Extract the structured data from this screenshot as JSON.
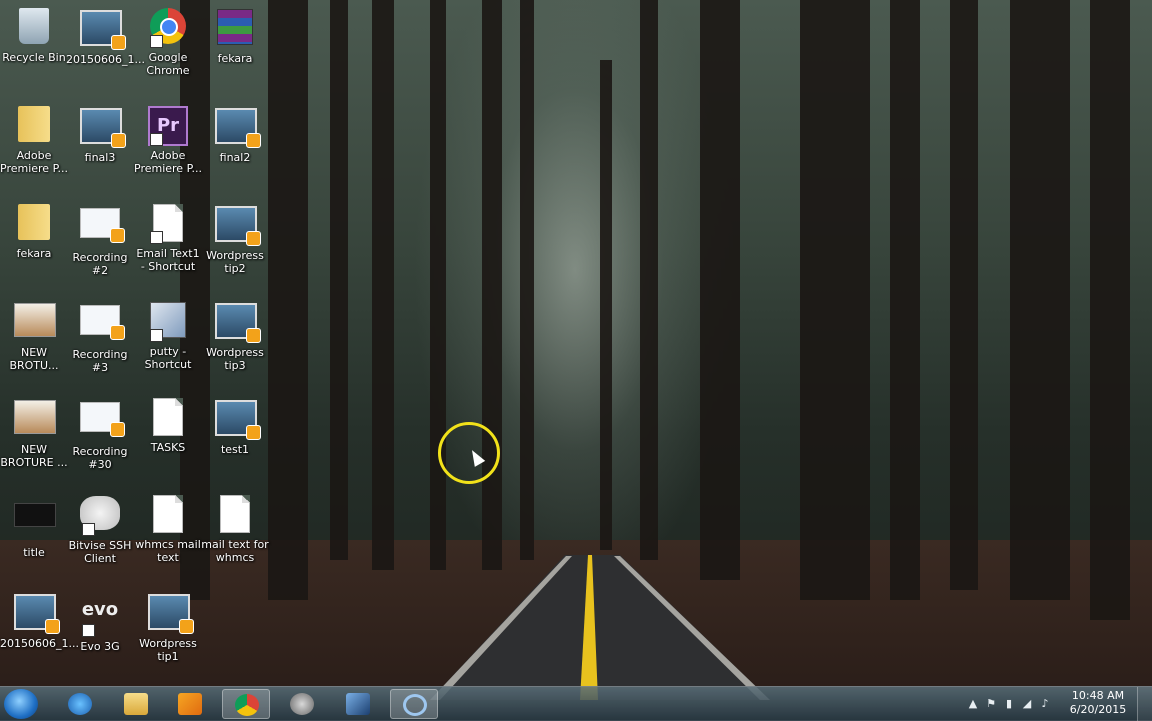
{
  "desktop": {
    "icons": [
      {
        "label": "Recycle Bin",
        "kind": "recycle-bin"
      },
      {
        "label": "20150606_1...",
        "kind": "video-file"
      },
      {
        "label": "Google Chrome",
        "kind": "chrome-shortcut"
      },
      {
        "label": "fekara",
        "kind": "rar-archive"
      },
      {
        "label": "Adobe Premiere P...",
        "kind": "folder"
      },
      {
        "label": "final3",
        "kind": "video-file"
      },
      {
        "label": "Adobe Premiere P...",
        "kind": "premiere-shortcut"
      },
      {
        "label": "final2",
        "kind": "video-file"
      },
      {
        "label": "fekara",
        "kind": "folder"
      },
      {
        "label": "Recording #2",
        "kind": "recording-file"
      },
      {
        "label": "Email Text1 - Shortcut",
        "kind": "text-shortcut"
      },
      {
        "label": "Wordpress tip2",
        "kind": "video-file"
      },
      {
        "label": "NEW BROTU...",
        "kind": "brochure-image"
      },
      {
        "label": "Recording #3",
        "kind": "recording-file"
      },
      {
        "label": "putty - Shortcut",
        "kind": "putty-shortcut"
      },
      {
        "label": "Wordpress tip3",
        "kind": "video-file"
      },
      {
        "label": "NEW BROTURE ...",
        "kind": "brochure-image"
      },
      {
        "label": "Recording #30",
        "kind": "recording-file"
      },
      {
        "label": "TASKS",
        "kind": "text-file"
      },
      {
        "label": "test1",
        "kind": "video-file"
      },
      {
        "label": "title",
        "kind": "title-image"
      },
      {
        "label": "Bitvise SSH Client",
        "kind": "bitvise-shortcut"
      },
      {
        "label": "whmcs mail text",
        "kind": "text-file"
      },
      {
        "label": "mail text for whmcs",
        "kind": "text-file"
      },
      {
        "label": "20150606_1...",
        "kind": "video-file"
      },
      {
        "label": "Evo 3G",
        "kind": "evo-shortcut"
      },
      {
        "label": "Wordpress tip1",
        "kind": "video-file"
      }
    ]
  },
  "taskbar": {
    "start_icon": "windows-start-orb",
    "pinned": [
      {
        "name": "internet-explorer-icon",
        "active": false
      },
      {
        "name": "windows-explorer-icon",
        "active": false
      },
      {
        "name": "media-player-icon",
        "active": false
      },
      {
        "name": "google-chrome-icon",
        "active": true
      },
      {
        "name": "webcam-icon",
        "active": false
      },
      {
        "name": "media-app-icon",
        "active": false
      },
      {
        "name": "circle-app-icon",
        "active": true
      }
    ],
    "tray": {
      "time": "10:48 AM",
      "date": "6/20/2015",
      "icons": [
        "show-hidden-icons",
        "flag-icon",
        "power-icon",
        "signal-icon",
        "volume-icon"
      ]
    }
  },
  "colors": {
    "cursor_highlight": "#f2e21a",
    "taskbar": "#2f4350"
  }
}
